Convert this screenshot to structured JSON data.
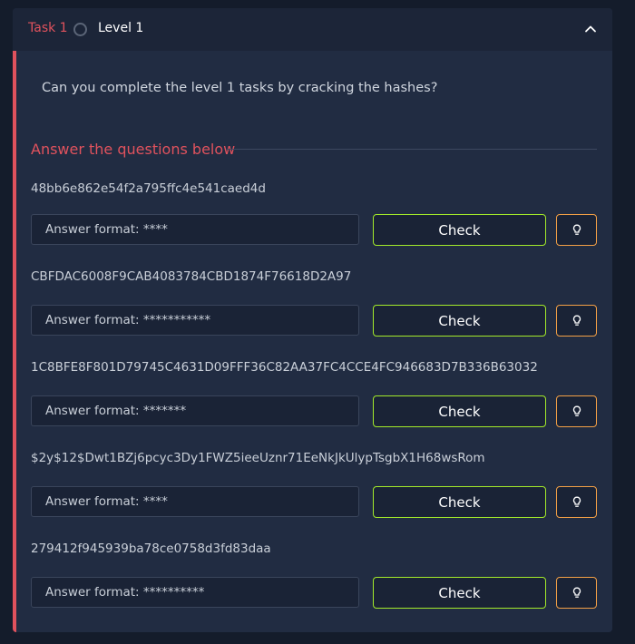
{
  "task": {
    "number_label": "Task 1",
    "title": "Level 1",
    "intro": "Can you complete the level 1 tasks by cracking the hashes?",
    "answer_heading": "Answer the questions below"
  },
  "colors": {
    "accent": "#e0525d",
    "check_border": "#a3ea2a",
    "hint_border": "#f3a046",
    "card_bg": "#212c42"
  },
  "questions": [
    {
      "hash": "48bb6e862e54f2a795ffc4e541caed4d",
      "placeholder": "Answer format: ****",
      "check_label": "Check"
    },
    {
      "hash": "CBFDAC6008F9CAB4083784CBD1874F76618D2A97",
      "placeholder": "Answer format: ***********",
      "check_label": "Check"
    },
    {
      "hash": "1C8BFE8F801D79745C4631D09FFF36C82AA37FC4CCE4FC946683D7B336B63032",
      "placeholder": "Answer format: *******",
      "check_label": "Check"
    },
    {
      "hash": "$2y$12$Dwt1BZj6pcyc3Dy1FWZ5ieeUznr71EeNkJkUlypTsgbX1H68wsRom",
      "placeholder": "Answer format: ****",
      "check_label": "Check"
    },
    {
      "hash": "279412f945939ba78ce0758d3fd83daa",
      "placeholder": "Answer format: **********",
      "check_label": "Check"
    }
  ]
}
